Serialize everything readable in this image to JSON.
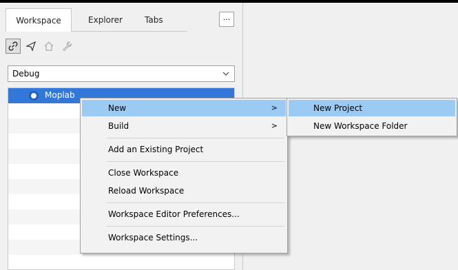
{
  "tabs": [
    {
      "label": "Workspace",
      "active": true
    },
    {
      "label": "Explorer",
      "active": false
    },
    {
      "label": "Tabs",
      "active": false
    }
  ],
  "more_button_label": "...",
  "toolbar": {
    "icons": [
      "link-icon",
      "send-icon",
      "home-icon",
      "wrench-icon"
    ]
  },
  "config_select": {
    "value": "Debug"
  },
  "tree": {
    "project_label": "Moplab"
  },
  "context_menu": {
    "items": [
      {
        "label": "New",
        "has_submenu": true,
        "highlighted": true
      },
      {
        "label": "Build",
        "has_submenu": true
      },
      {
        "label": "Add an Existing Project"
      },
      {
        "label": "Close Workspace"
      },
      {
        "label": "Reload Workspace"
      },
      {
        "label": "Workspace Editor Preferences..."
      },
      {
        "label": "Workspace Settings..."
      }
    ],
    "arrow": ">"
  },
  "submenu": {
    "items": [
      {
        "label": "New Project",
        "highlighted": true
      },
      {
        "label": "New Workspace Folder"
      }
    ]
  },
  "colors": {
    "selection": "#3377d9",
    "menu_highlight": "#9bcbf5",
    "menu_background": "#f2f2f2"
  }
}
